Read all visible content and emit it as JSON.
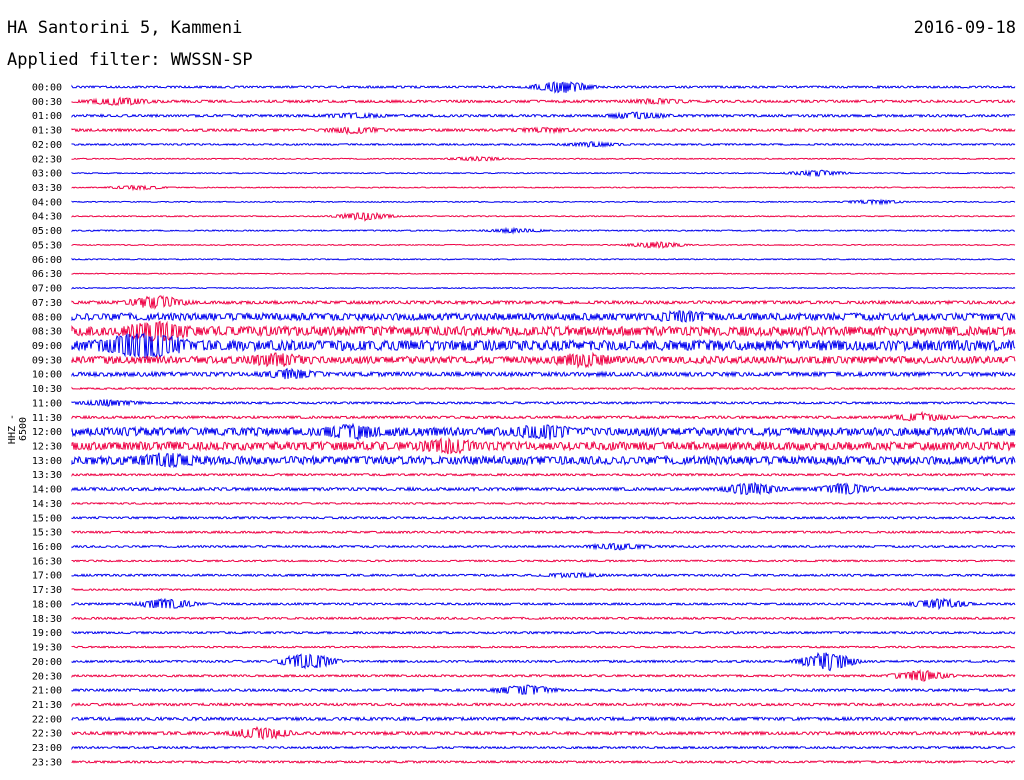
{
  "header": {
    "station": "HA Santorini 5, Kammeni",
    "date": "2016-09-18",
    "filter": "Applied filter: WWSSN-SP"
  },
  "chart_data": {
    "type": "line",
    "channel_label": "HHZ - 6500",
    "colors": [
      "#0000ee",
      "#ee0044"
    ],
    "rows": [
      {
        "label": "00:00",
        "amp": 1.0,
        "events": [
          [
            0.52,
            6
          ]
        ]
      },
      {
        "label": "00:30",
        "amp": 1.2,
        "events": [
          [
            0.04,
            2
          ],
          [
            0.06,
            2
          ],
          [
            0.62,
            2
          ]
        ]
      },
      {
        "label": "01:00",
        "amp": 1.2,
        "events": [
          [
            0.3,
            2
          ],
          [
            0.6,
            3
          ]
        ]
      },
      {
        "label": "01:30",
        "amp": 1.2,
        "events": [
          [
            0.3,
            3
          ],
          [
            0.5,
            2
          ]
        ]
      },
      {
        "label": "02:00",
        "amp": 0.8,
        "events": [
          [
            0.55,
            2
          ]
        ]
      },
      {
        "label": "02:30",
        "amp": 0.5,
        "events": [
          [
            0.43,
            2
          ]
        ]
      },
      {
        "label": "03:00",
        "amp": 0.5,
        "events": [
          [
            0.79,
            3
          ]
        ]
      },
      {
        "label": "03:30",
        "amp": 0.5,
        "events": [
          [
            0.07,
            2
          ]
        ]
      },
      {
        "label": "04:00",
        "amp": 0.5,
        "events": [
          [
            0.85,
            2
          ]
        ]
      },
      {
        "label": "04:30",
        "amp": 0.5,
        "events": [
          [
            0.31,
            4
          ]
        ]
      },
      {
        "label": "05:00",
        "amp": 0.6,
        "events": [
          [
            0.47,
            2
          ]
        ]
      },
      {
        "label": "05:30",
        "amp": 0.5,
        "events": [
          [
            0.62,
            3
          ]
        ]
      },
      {
        "label": "06:00",
        "amp": 0.5,
        "events": []
      },
      {
        "label": "06:30",
        "amp": 0.4,
        "events": []
      },
      {
        "label": "07:00",
        "amp": 0.5,
        "events": []
      },
      {
        "label": "07:30",
        "amp": 1.5,
        "events": [
          [
            0.09,
            6
          ]
        ]
      },
      {
        "label": "08:00",
        "amp": 3.5,
        "events": [
          [
            0.65,
            3
          ]
        ]
      },
      {
        "label": "08:30",
        "amp": 4.5,
        "events": [
          [
            0.09,
            8
          ]
        ]
      },
      {
        "label": "09:00",
        "amp": 5.0,
        "events": [
          [
            0.06,
            8
          ],
          [
            0.09,
            8
          ]
        ]
      },
      {
        "label": "09:30",
        "amp": 3.5,
        "events": [
          [
            0.22,
            5
          ],
          [
            0.54,
            5
          ]
        ]
      },
      {
        "label": "10:00",
        "amp": 2.0,
        "events": [
          [
            0.23,
            4
          ]
        ]
      },
      {
        "label": "10:30",
        "amp": 0.8,
        "events": []
      },
      {
        "label": "11:00",
        "amp": 1.0,
        "events": [
          [
            0.04,
            3
          ]
        ]
      },
      {
        "label": "11:30",
        "amp": 1.2,
        "events": [
          [
            0.9,
            4
          ]
        ]
      },
      {
        "label": "12:00",
        "amp": 4.0,
        "events": [
          [
            0.3,
            5
          ],
          [
            0.5,
            5
          ]
        ]
      },
      {
        "label": "12:30",
        "amp": 4.0,
        "events": [
          [
            0.4,
            5
          ]
        ]
      },
      {
        "label": "13:00",
        "amp": 4.0,
        "events": [
          [
            0.1,
            5
          ]
        ]
      },
      {
        "label": "13:30",
        "amp": 1.0,
        "events": []
      },
      {
        "label": "14:00",
        "amp": 1.5,
        "events": [
          [
            0.72,
            6
          ],
          [
            0.82,
            5
          ]
        ]
      },
      {
        "label": "14:30",
        "amp": 0.8,
        "events": []
      },
      {
        "label": "15:00",
        "amp": 1.0,
        "events": []
      },
      {
        "label": "15:30",
        "amp": 1.0,
        "events": []
      },
      {
        "label": "16:00",
        "amp": 1.0,
        "events": [
          [
            0.58,
            3
          ]
        ]
      },
      {
        "label": "16:30",
        "amp": 0.8,
        "events": []
      },
      {
        "label": "17:00",
        "amp": 1.0,
        "events": [
          [
            0.53,
            2
          ]
        ]
      },
      {
        "label": "17:30",
        "amp": 0.8,
        "events": []
      },
      {
        "label": "18:00",
        "amp": 1.0,
        "events": [
          [
            0.1,
            5
          ],
          [
            0.92,
            5
          ]
        ]
      },
      {
        "label": "18:30",
        "amp": 1.0,
        "events": []
      },
      {
        "label": "19:00",
        "amp": 1.0,
        "events": []
      },
      {
        "label": "19:30",
        "amp": 0.8,
        "events": []
      },
      {
        "label": "20:00",
        "amp": 1.0,
        "events": [
          [
            0.25,
            8
          ],
          [
            0.8,
            10
          ]
        ]
      },
      {
        "label": "20:30",
        "amp": 1.0,
        "events": [
          [
            0.9,
            5
          ]
        ]
      },
      {
        "label": "21:00",
        "amp": 1.2,
        "events": [
          [
            0.48,
            5
          ]
        ]
      },
      {
        "label": "21:30",
        "amp": 1.2,
        "events": []
      },
      {
        "label": "22:00",
        "amp": 1.5,
        "events": []
      },
      {
        "label": "22:30",
        "amp": 1.5,
        "events": [
          [
            0.2,
            6
          ]
        ]
      },
      {
        "label": "23:00",
        "amp": 1.0,
        "events": []
      },
      {
        "label": "23:30",
        "amp": 1.0,
        "events": []
      }
    ]
  }
}
